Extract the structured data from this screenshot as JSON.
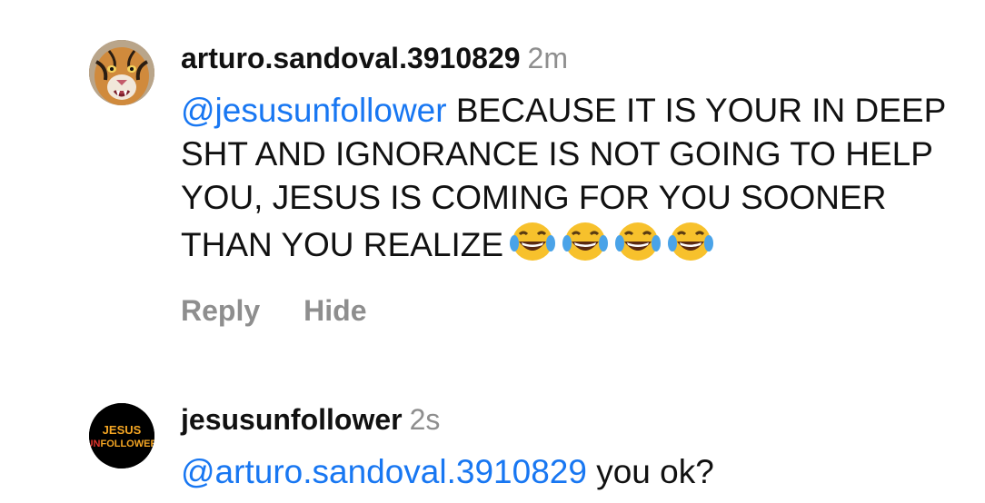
{
  "comments": [
    {
      "username": "arturo.sandoval.3910829",
      "time": "2m",
      "mention": "@jesusunfollower",
      "text": "BECAUSE IT IS YOUR IN DEEP SHT AND IGNORANCE IS NOT GOING TO HELP YOU, JESUS IS COMING FOR YOU SOONER THAN YOU REALIZE",
      "emojis": [
        "face-with-tears-of-joy-icon",
        "face-with-tears-of-joy-icon",
        "face-with-tears-of-joy-icon",
        "face-with-tears-of-joy-icon"
      ],
      "actions": {
        "reply": "Reply",
        "hide": "Hide"
      },
      "avatar_icon": "tiger-avatar"
    },
    {
      "username": "jesusunfollower",
      "time": "2s",
      "mention": "@arturo.sandoval.3910829",
      "text": "you ok?",
      "avatar_logo": {
        "line1": "JESUS",
        "line2_prefix": "UN",
        "line2_rest": "FOLLOWER"
      }
    }
  ],
  "colors": {
    "mention": "#1877f2",
    "muted": "#8e8e8e",
    "text": "#111111",
    "logo_text": "#f5a623",
    "logo_accent": "#e0332b"
  }
}
